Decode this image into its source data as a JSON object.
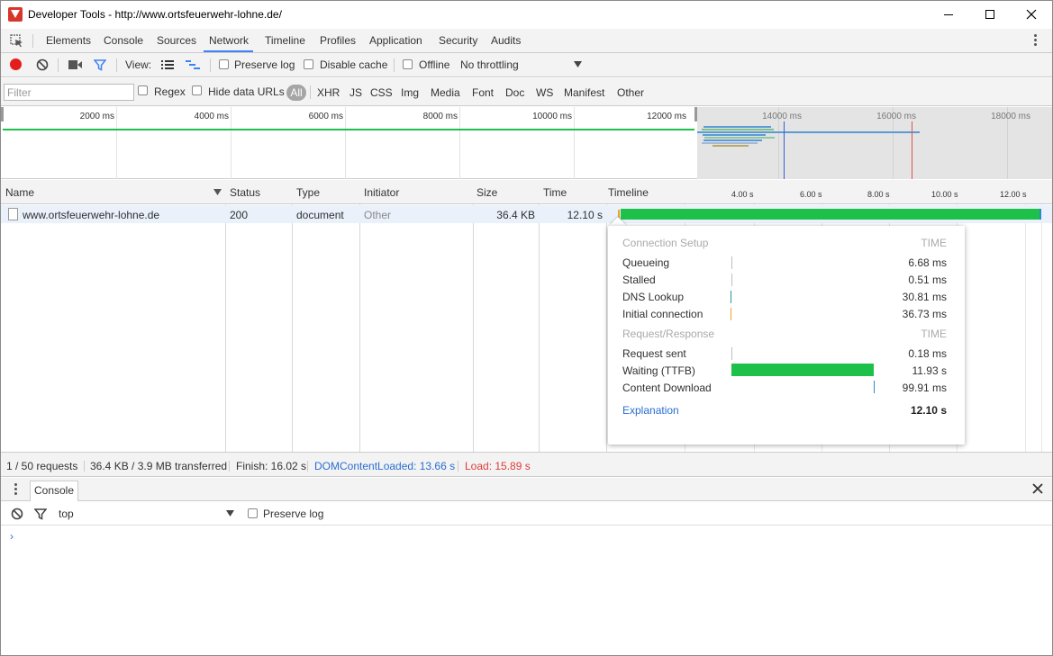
{
  "window": {
    "title": "Developer Tools - http://www.ortsfeuerwehr-lohne.de/"
  },
  "tabs": [
    "Elements",
    "Console",
    "Sources",
    "Network",
    "Timeline",
    "Profiles",
    "Application",
    "Security",
    "Audits"
  ],
  "active_tab": "Network",
  "toolbar": {
    "view_label": "View:",
    "preserve_log": "Preserve log",
    "disable_cache": "Disable cache",
    "offline": "Offline",
    "throttling": "No throttling"
  },
  "filter": {
    "placeholder": "Filter",
    "regex": "Regex",
    "hide_data_urls": "Hide data URLs",
    "types": [
      "All",
      "XHR",
      "JS",
      "CSS",
      "Img",
      "Media",
      "Font",
      "Doc",
      "WS",
      "Manifest",
      "Other"
    ]
  },
  "overview": {
    "ticks": [
      "2000 ms",
      "4000 ms",
      "6000 ms",
      "8000 ms",
      "10000 ms",
      "12000 ms",
      "14000 ms",
      "16000 ms",
      "18000 ms"
    ]
  },
  "columns": [
    "Name",
    "Status",
    "Type",
    "Initiator",
    "Size",
    "Time",
    "Timeline"
  ],
  "timeline_ticks": [
    "4.00 s",
    "6.00 s",
    "8.00 s",
    "10.00 s",
    "12.00 s"
  ],
  "row": {
    "name": "www.ortsfeuerwehr-lohne.de",
    "status": "200",
    "type": "document",
    "initiator": "Other",
    "size": "36.4 KB",
    "time": "12.10 s"
  },
  "popover": {
    "connection_setup": "Connection Setup",
    "time_head": "TIME",
    "request_response": "Request/Response",
    "time_head2": "TIME",
    "rows": [
      {
        "label": "Queueing",
        "value": "6.68 ms",
        "color": "#bdbdbd"
      },
      {
        "label": "Stalled",
        "value": "0.51 ms",
        "color": "#bdbdbd"
      },
      {
        "label": "DNS Lookup",
        "value": "30.81 ms",
        "color": "#1e9e8f"
      },
      {
        "label": "Initial connection",
        "value": "36.73 ms",
        "color": "#f0a030"
      },
      {
        "label": "Request sent",
        "value": "0.18 ms",
        "color": "#bdbdbd"
      },
      {
        "label": "Waiting (TTFB)",
        "value": "11.93 s",
        "color": "#1dc14a"
      },
      {
        "label": "Content Download",
        "value": "99.91 ms",
        "color": "#2f87d1"
      }
    ],
    "explanation": "Explanation",
    "total": "12.10 s"
  },
  "status_bar": {
    "requests": "1 / 50 requests",
    "transferred": "36.4 KB / 3.9 MB transferred",
    "finish": "Finish: 16.02 s",
    "dom_content_loaded": "DOMContentLoaded: 13.66 s",
    "load": "Load: 15.89 s"
  },
  "drawer": {
    "tab": "Console",
    "context": "top",
    "preserve_log": "Preserve log",
    "prompt": "›"
  },
  "colors": {
    "accent": "#3e82f7",
    "dcl": "#2a6fd0",
    "load": "#e03b3b",
    "waiting": "#1dc14a"
  }
}
